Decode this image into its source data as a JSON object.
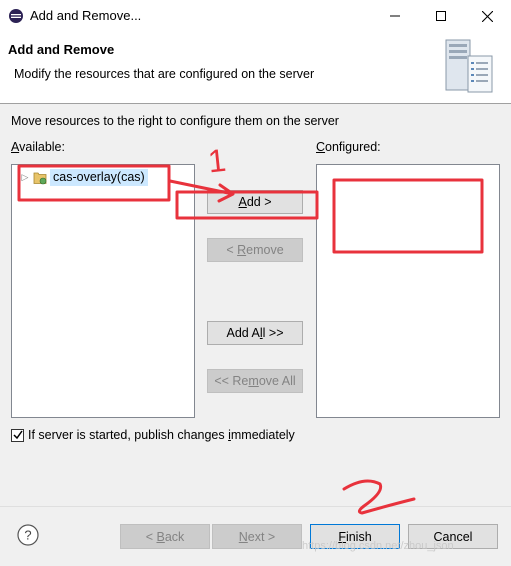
{
  "window": {
    "title": "Add and Remove...",
    "minimize_symbol": "—",
    "maximize_symbol": "☐",
    "close_symbol": "✕"
  },
  "header": {
    "title": "Add and Remove",
    "description": "Modify the resources that are configured on the server",
    "icon": "server-icon"
  },
  "body": {
    "instruction": "Move resources to the right to configure them on the server",
    "available_label_prefix": "A",
    "available_label_rest": "vailable:",
    "configured_label_prefix": "C",
    "configured_label_rest": "onfigured:",
    "available_items": [
      {
        "label": "cas-overlay(cas)",
        "icon": "project-icon",
        "selected": true
      }
    ],
    "configured_items": []
  },
  "buttons": {
    "add_prefix": "",
    "add_mnemonic": "A",
    "add_rest": "dd >",
    "remove_prefix": "< ",
    "remove_mnemonic": "R",
    "remove_rest": "emove",
    "addall_prefix": "Add A",
    "addall_mnemonic": "l",
    "addall_rest": "l >>",
    "removeall_prefix": "<< Re",
    "removeall_mnemonic": "m",
    "removeall_rest": "ove All"
  },
  "publish": {
    "checked": true,
    "label_prefix": "If server is started, publish changes ",
    "label_mnemonic": "i",
    "label_rest": "mmediately"
  },
  "footer": {
    "back_prefix": "< ",
    "back_mnemonic": "B",
    "back_rest": "ack",
    "next_mnemonic": "N",
    "next_rest": "ext >",
    "finish_mnemonic": "F",
    "finish_rest": "inish",
    "cancel": "Cancel"
  },
  "annotations": {
    "step_1": "1",
    "step_2": "2",
    "color": "#e8323c"
  },
  "watermark": "https://blog.csdn.net/zhou_json"
}
